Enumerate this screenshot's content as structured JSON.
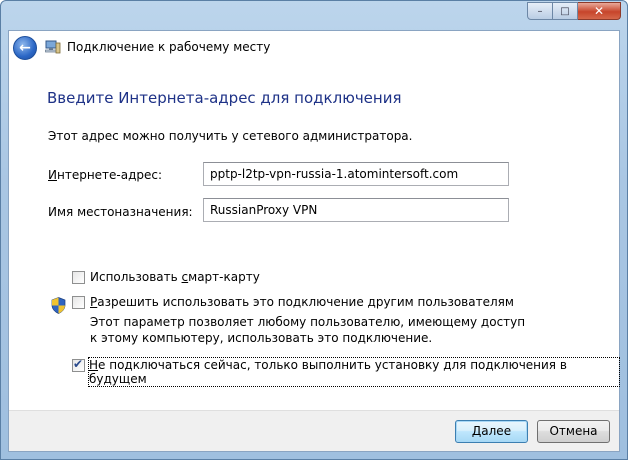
{
  "window": {
    "buttons": {
      "minimize": "–",
      "maximize": "□",
      "close": "✕"
    }
  },
  "nav": {
    "back_icon": "back-arrow-icon",
    "app_icon": "network-workplace-icon",
    "title": "Подключение к рабочему месту"
  },
  "page": {
    "heading": "Введите Интернета-адрес для подключения",
    "description": "Этот адрес можно получить у сетевого администратора.",
    "address_label_hotkey": "И",
    "address_label_rest": "нтернете-адрес:",
    "address_value": "pptp-l2tp-vpn-russia-1.atomintersoft.com",
    "dest_label": "Имя местоназначения:",
    "dest_value": "RussianProxy VPN",
    "smartcard_pre": "Использовать ",
    "smartcard_hotkey": "с",
    "smartcard_post": "март-карту",
    "smartcard_checked": false,
    "allow_hotkey": "Р",
    "allow_rest": "азрешить использовать это подключение другим пользователям",
    "allow_checked": false,
    "allow_note": "Этот параметр позволяет любому пользователю, имеющему доступ к этому компьютеру, использовать это подключение.",
    "noconnect_hotkey": "Н",
    "noconnect_rest": "е подключаться сейчас, только выполнить установку для подключения в будущем",
    "noconnect_checked": true,
    "shield_icon": "uac-shield-icon"
  },
  "footer": {
    "next_hotkey": "Д",
    "next_rest": "алее",
    "cancel": "Отмена"
  }
}
